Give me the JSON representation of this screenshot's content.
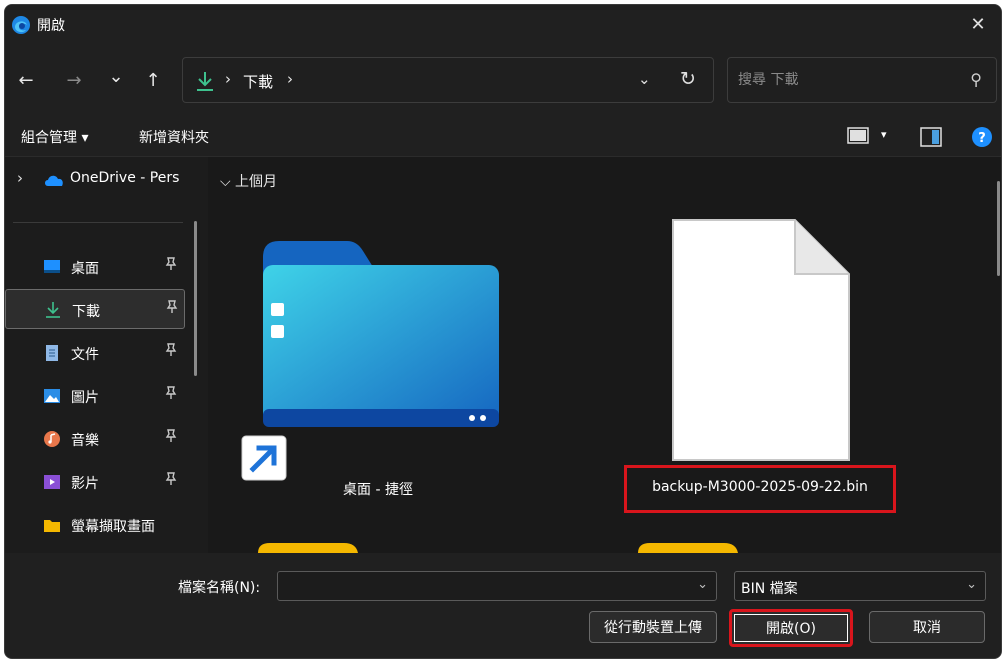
{
  "window": {
    "title": "開啟",
    "close_glyph": "✕"
  },
  "nav": {
    "back_glyph": "←",
    "forward_glyph": "→",
    "recent_glyph": "⌄",
    "up_glyph": "↑",
    "separator": "›",
    "path_label": "下載",
    "dropdown_glyph": "⌄",
    "refresh_glyph": "↻",
    "search_placeholder": "搜尋 下載",
    "search_glyph": "⚲"
  },
  "commands": {
    "organize": "組合管理 ▾",
    "new_folder": "新增資料夾",
    "view_dropdown": "▾",
    "help_glyph": "?"
  },
  "sidebar": {
    "expander": "›",
    "onedrive_label": "OneDrive - Pers",
    "pin_glyph": "📌",
    "items": [
      {
        "label": "桌面",
        "pinned": true
      },
      {
        "label": "下載",
        "pinned": true,
        "active": true
      },
      {
        "label": "文件",
        "pinned": true
      },
      {
        "label": "圖片",
        "pinned": true
      },
      {
        "label": "音樂",
        "pinned": true
      },
      {
        "label": "影片",
        "pinned": true
      },
      {
        "label": "螢幕擷取畫面",
        "pinned": false
      }
    ]
  },
  "main": {
    "group_header": "⌵  上個月",
    "items": [
      {
        "label": "桌面 - 捷徑",
        "kind": "folder-shortcut"
      },
      {
        "label": "backup-M3000-2025-09-22.bin",
        "kind": "file",
        "highlighted": true
      }
    ]
  },
  "footer": {
    "filename_label": "檔案名稱(N):",
    "filename_value": "",
    "filetype_value": "BIN 檔案",
    "chevron": "⌄",
    "upload_button": "從行動裝置上傳",
    "open_button": "開啟(O)",
    "cancel_button": "取消"
  },
  "colors": {
    "highlight": "#d9151c",
    "accent_blue": "#0078d4",
    "download_green": "#3ec18e"
  }
}
